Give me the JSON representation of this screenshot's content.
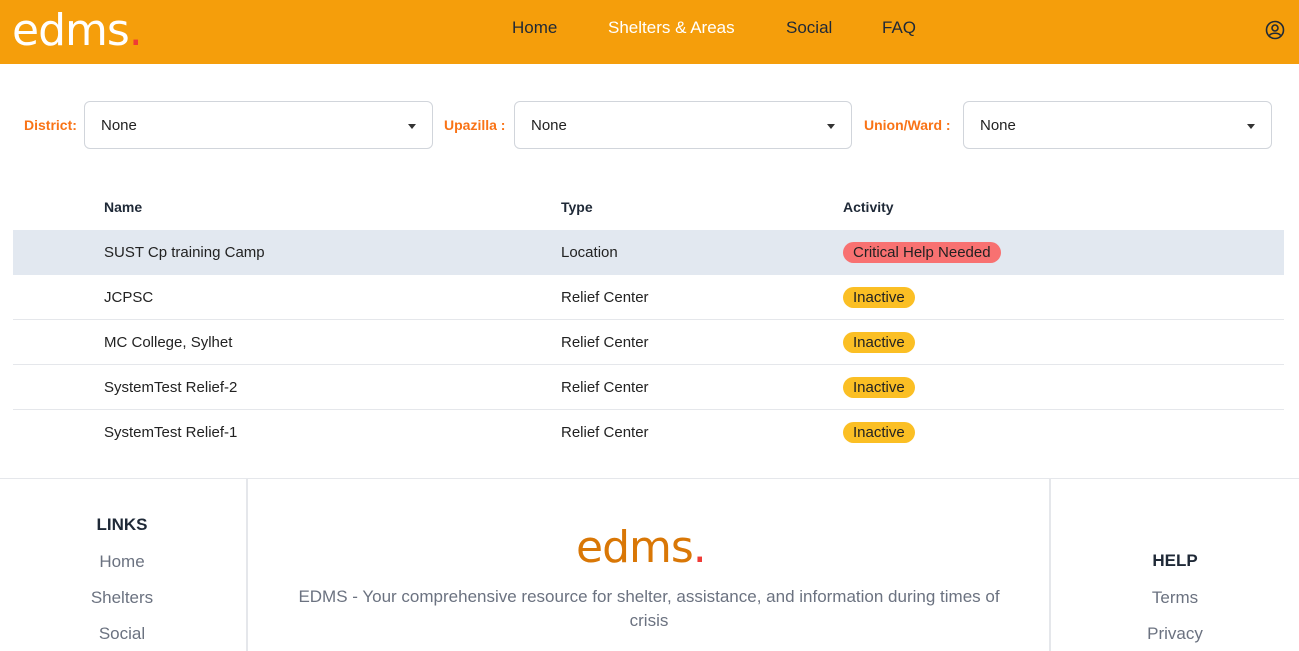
{
  "header": {
    "logo_text": "edms",
    "logo_dot": ".",
    "nav": [
      {
        "label": "Home"
      },
      {
        "label": "Shelters & Areas"
      },
      {
        "label": "Social"
      },
      {
        "label": "FAQ"
      }
    ],
    "active_nav": "Shelters & Areas",
    "user_icon": "user-circle-icon"
  },
  "filters": [
    {
      "label": "District:",
      "value": "None"
    },
    {
      "label": "Upazilla :",
      "value": "None"
    },
    {
      "label": "Union/Ward :",
      "value": "None"
    }
  ],
  "table": {
    "columns": [
      "Name",
      "Type",
      "Activity"
    ],
    "rows": [
      {
        "name": "SUST Cp training Camp",
        "type": "Location",
        "activity": "Critical Help Needed",
        "status": "critical"
      },
      {
        "name": "JCPSC",
        "type": "Relief Center",
        "activity": "Inactive",
        "status": "inactive"
      },
      {
        "name": "MC College, Sylhet",
        "type": "Relief Center",
        "activity": "Inactive",
        "status": "inactive"
      },
      {
        "name": "SystemTest Relief-2",
        "type": "Relief Center",
        "activity": "Inactive",
        "status": "inactive"
      },
      {
        "name": "SystemTest Relief-1",
        "type": "Relief Center",
        "activity": "Inactive",
        "status": "inactive"
      }
    ]
  },
  "footer": {
    "links_heading": "LINKS",
    "links": [
      "Home",
      "Shelters",
      "Social"
    ],
    "logo_text": "edms",
    "logo_dot": ".",
    "description": "EDMS - Your comprehensive resource for shelter, assistance, and information during times of crisis",
    "help_heading": "HELP",
    "help_links": [
      "Terms",
      "Privacy"
    ]
  },
  "colors": {
    "header_bg": "#f59e0b",
    "accent_label": "#f97316",
    "critical": "#f87171",
    "inactive": "#fbbf24",
    "highlight_row": "#e2e8f0"
  }
}
